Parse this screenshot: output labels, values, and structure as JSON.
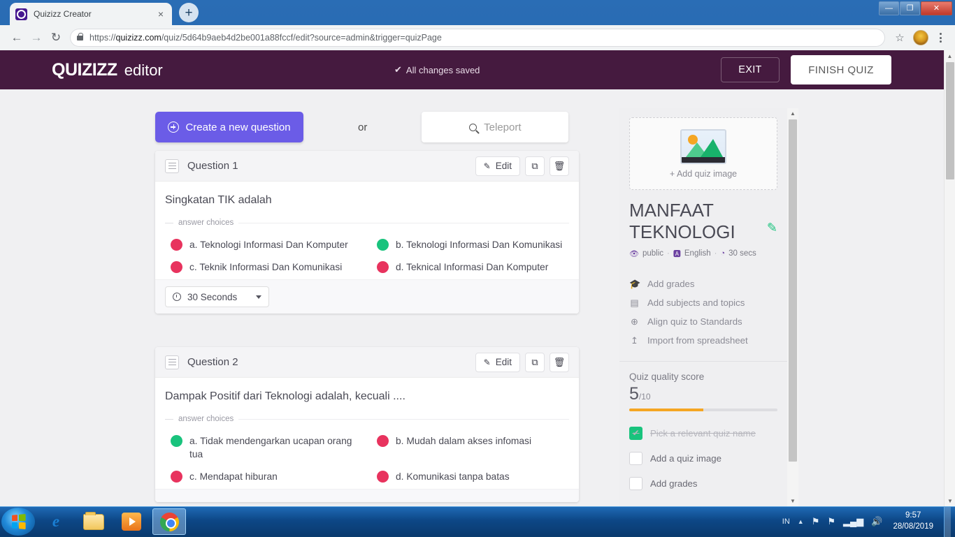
{
  "browser": {
    "tab_title": "Quizizz Creator",
    "tab_close": "×",
    "new_tab": "+",
    "back": "←",
    "forward": "→",
    "reload": "↻",
    "url_prefix": "https://",
    "url_domain": "quizizz.com",
    "url_path": "/quiz/5d64b9aeb4d2be001a88fccf/edit?source=admin&trigger=quizPage",
    "bookmark_star": "☆",
    "minimize": "—",
    "maximize": "❐",
    "close": "✕"
  },
  "header": {
    "logo": "QUIZIZZ",
    "editor_label": "editor",
    "saved_check": "✔",
    "saved_text": "All changes saved",
    "exit_label": "EXIT",
    "finish_label": "FINISH QUIZ",
    "bg_color": "#451a3f"
  },
  "toolbar": {
    "create_label": "Create a new question",
    "or_label": "or",
    "teleport_placeholder": "Teleport"
  },
  "questions": [
    {
      "header": "Question 1",
      "edit_label": "Edit",
      "duplicate_icon": "⧉",
      "delete_icon": "🗑",
      "text": "Singkatan TIK adalah",
      "answer_choices_label": "answer choices",
      "choices": [
        {
          "label": "a. Teknologi Informasi Dan Komputer",
          "correct": false
        },
        {
          "label": "b. Teknologi Informasi Dan Komunikasi",
          "correct": true
        },
        {
          "label": "c. Teknik Informasi Dan Komunikasi",
          "correct": false
        },
        {
          "label": "d. Teknical Informasi Dan Komputer",
          "correct": false
        }
      ],
      "timer": "30 Seconds"
    },
    {
      "header": "Question 2",
      "edit_label": "Edit",
      "duplicate_icon": "⧉",
      "delete_icon": "🗑",
      "text": "Dampak Positif dari Teknologi adalah, kecuali ....",
      "answer_choices_label": "answer choices",
      "choices": [
        {
          "label": "a. Tidak mendengarkan ucapan orang tua",
          "correct": true
        },
        {
          "label": "b. Mudah dalam akses infomasi",
          "correct": false
        },
        {
          "label": "c. Mendapat hiburan",
          "correct": false
        },
        {
          "label": "d. Komunikasi tanpa batas",
          "correct": false
        }
      ]
    }
  ],
  "sidebar": {
    "add_image_label": "+ Add quiz image",
    "quiz_name": "MANFAAT TEKNOLOGI",
    "edit_icon": "✎",
    "meta": {
      "visibility_icon": "👁",
      "visibility": "public",
      "language_icon": "🅰",
      "language": "English",
      "time_icon": "◔",
      "time": "30 secs",
      "separator": "·"
    },
    "menu": [
      {
        "icon": "🎓",
        "label": "Add grades"
      },
      {
        "icon": "▤",
        "label": "Add subjects and topics"
      },
      {
        "icon": "⊕",
        "label": "Align quiz to Standards"
      },
      {
        "icon": "↥",
        "label": "Import from spreadsheet"
      }
    ],
    "quality": {
      "title": "Quiz quality score",
      "score": "5",
      "out_of": "/10",
      "percent": 50,
      "bar_color": "#f5a623"
    },
    "checklist": [
      {
        "label": "Pick a relevant quiz name",
        "checked": true
      },
      {
        "label": "Add a quiz image",
        "checked": false
      },
      {
        "label": "Add grades",
        "checked": false
      }
    ],
    "check_glyph": "✔"
  },
  "colors": {
    "correct_dot": "#19c37d",
    "incorrect_dot": "#e8335e",
    "primary_button": "#6b5ce7"
  },
  "taskbar": {
    "language": "IN",
    "show_hidden": "▲",
    "flag_icon": "⚑",
    "action_icon": "⚑",
    "network_icon": "▂▄▆",
    "volume_icon": "🔊",
    "time": "9:57",
    "date": "28/08/2019"
  }
}
